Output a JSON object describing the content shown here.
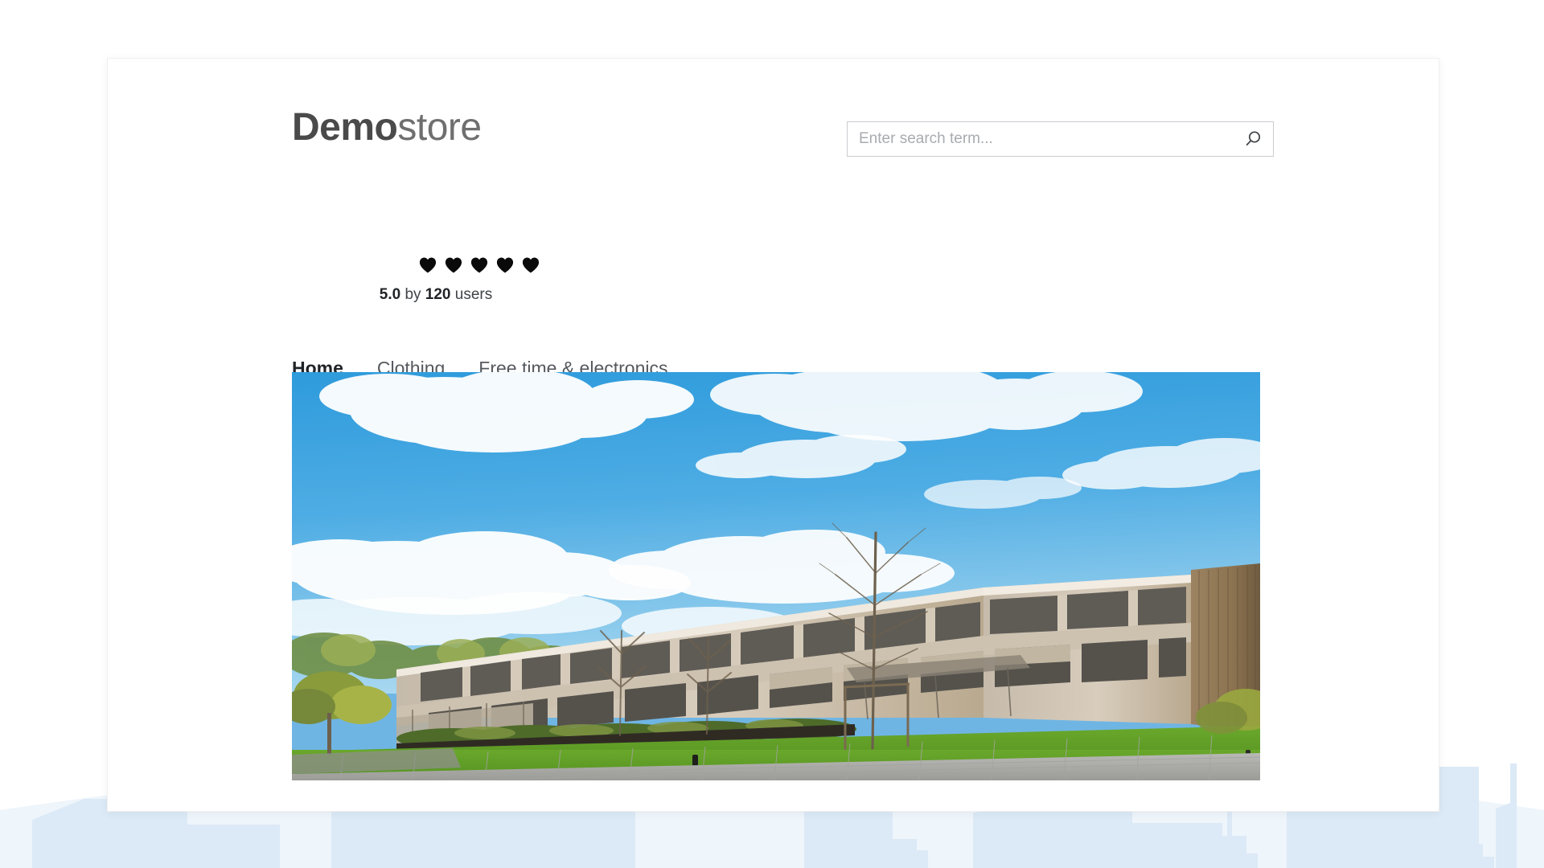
{
  "brand": {
    "name_bold": "Demo",
    "name_light": "store",
    "accent_color": "#1b5e9e"
  },
  "search": {
    "placeholder": "Enter search term...",
    "value": "",
    "icon": "search-icon"
  },
  "rating": {
    "icon": "heart-icon",
    "hearts_total": 5,
    "hearts_filled": 5,
    "score": "5.0",
    "connector": " by ",
    "count": "120",
    "suffix": " users"
  },
  "nav": {
    "items": [
      {
        "label": "Home",
        "active": true
      },
      {
        "label": "Clothing",
        "active": false
      },
      {
        "label": "Free time & electronics",
        "active": false
      }
    ]
  },
  "hero": {
    "alt": "Modern two-story wood-clad office building with green lawn, bare trees and paved walkway under a blue sky with white clouds",
    "colors": {
      "sky_top": "#3ea3de",
      "sky_bottom": "#9ed3ef",
      "cloud": "#ffffff",
      "facade": "#cfc4b3",
      "wood": "#a8906e",
      "glass": "#5d5a55",
      "grass": "#5d9e28",
      "pavement": "#b7b7b5"
    }
  },
  "backdrop": {
    "skyline_color": "#dce9f6",
    "skyline_haze": "#eef5fb"
  }
}
